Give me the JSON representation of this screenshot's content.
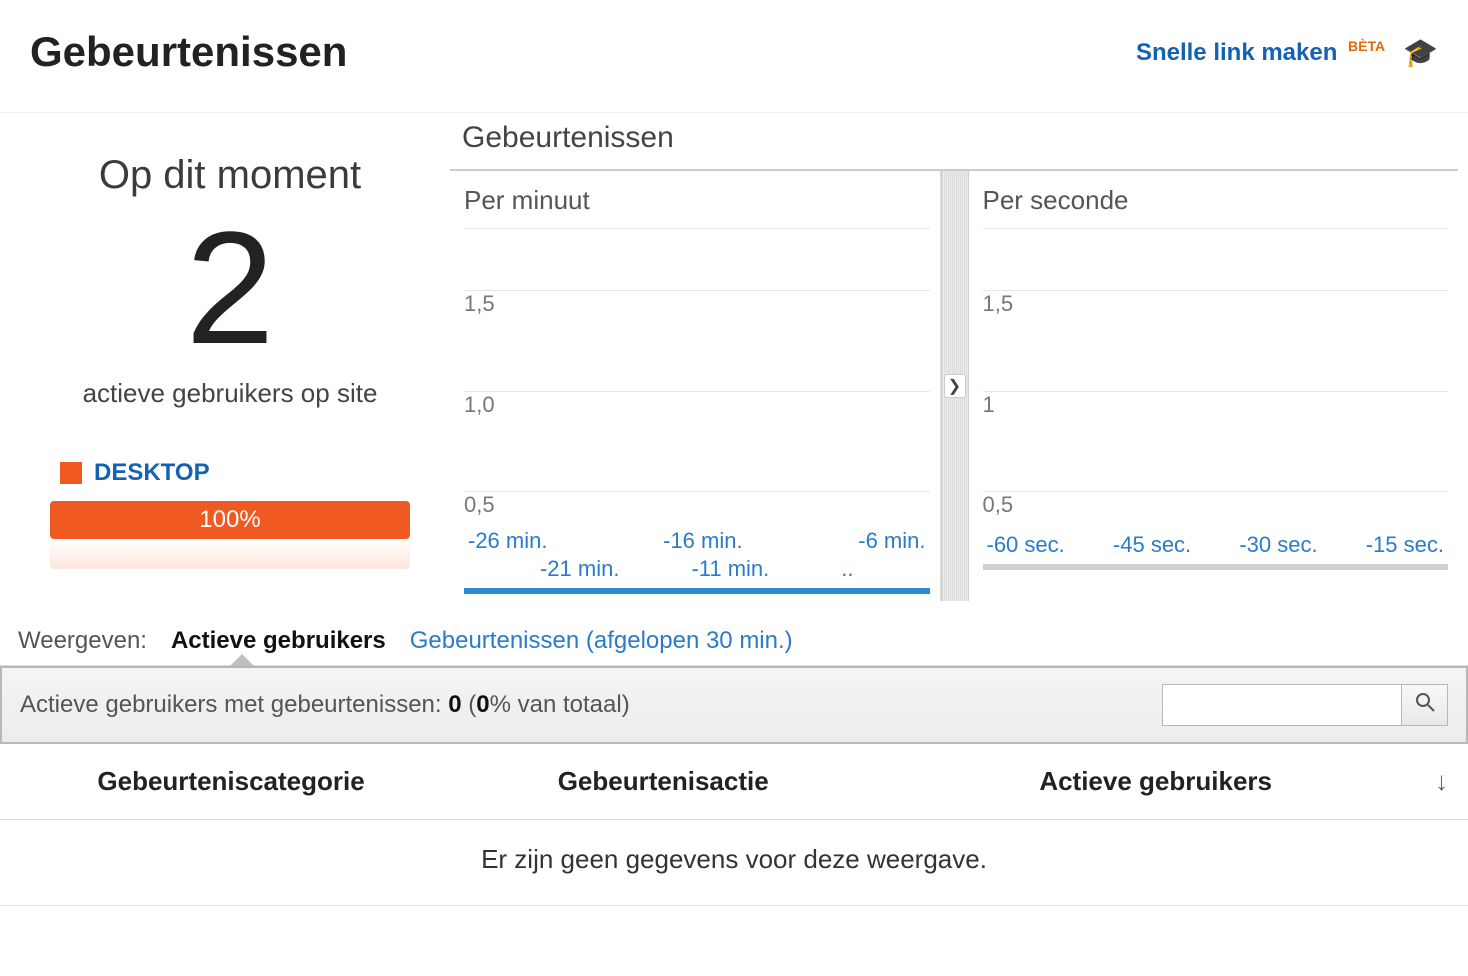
{
  "header": {
    "title": "Gebeurtenissen",
    "quick_link_label": "Snelle link maken",
    "beta_label": "BÈTA"
  },
  "left_panel": {
    "moment_label": "Op dit moment",
    "count": "2",
    "active_users_label": "actieve gebruikers op site",
    "device_legend_label": "DESKTOP",
    "device_bar_percent": "100%"
  },
  "charts": {
    "section_title": "Gebeurtenissen",
    "per_minute_title": "Per minuut",
    "per_second_title": "Per seconde",
    "y_ticks": [
      "1,5",
      "1,0",
      "0,5"
    ],
    "y_ticks_sec": [
      "1,5",
      "1",
      "0,5"
    ],
    "x_minute_row1": [
      "-26 min.",
      "-16 min.",
      "-6 min."
    ],
    "x_minute_row2": [
      "-21 min.",
      "-11 min."
    ],
    "x_second": [
      "-60 sec.",
      "-45 sec.",
      "-30 sec.",
      "-15 sec."
    ]
  },
  "chart_data": [
    {
      "type": "bar",
      "title": "Per minuut",
      "categories": [
        "-26 min.",
        "-21 min.",
        "-16 min.",
        "-11 min.",
        "-6 min."
      ],
      "values": [
        0,
        0,
        0,
        0,
        0
      ],
      "ylabel": "Gebeurtenissen",
      "ylim": [
        0,
        1.5
      ],
      "y_ticks": [
        0.5,
        1.0,
        1.5
      ]
    },
    {
      "type": "bar",
      "title": "Per seconde",
      "categories": [
        "-60 sec.",
        "-45 sec.",
        "-30 sec.",
        "-15 sec."
      ],
      "values": [
        0,
        0,
        0,
        0
      ],
      "ylabel": "Gebeurtenissen",
      "ylim": [
        0,
        1.5
      ],
      "y_ticks": [
        0.5,
        1.0,
        1.5
      ]
    }
  ],
  "view_tabs": {
    "label": "Weergeven:",
    "active": "Actieve gebruikers",
    "inactive": "Gebeurtenissen (afgelopen 30 min.)"
  },
  "filter_bar": {
    "prefix": "Actieve gebruikers met gebeurtenissen: ",
    "count": "0",
    "percent_open": " (",
    "percent_bold": "0",
    "percent_suffix": "% van totaal)"
  },
  "table": {
    "col1": "Gebeurteniscategorie",
    "col2": "Gebeurtenisactie",
    "col3": "Actieve gebruikers",
    "empty": "Er zijn geen gegevens voor deze weergave."
  }
}
